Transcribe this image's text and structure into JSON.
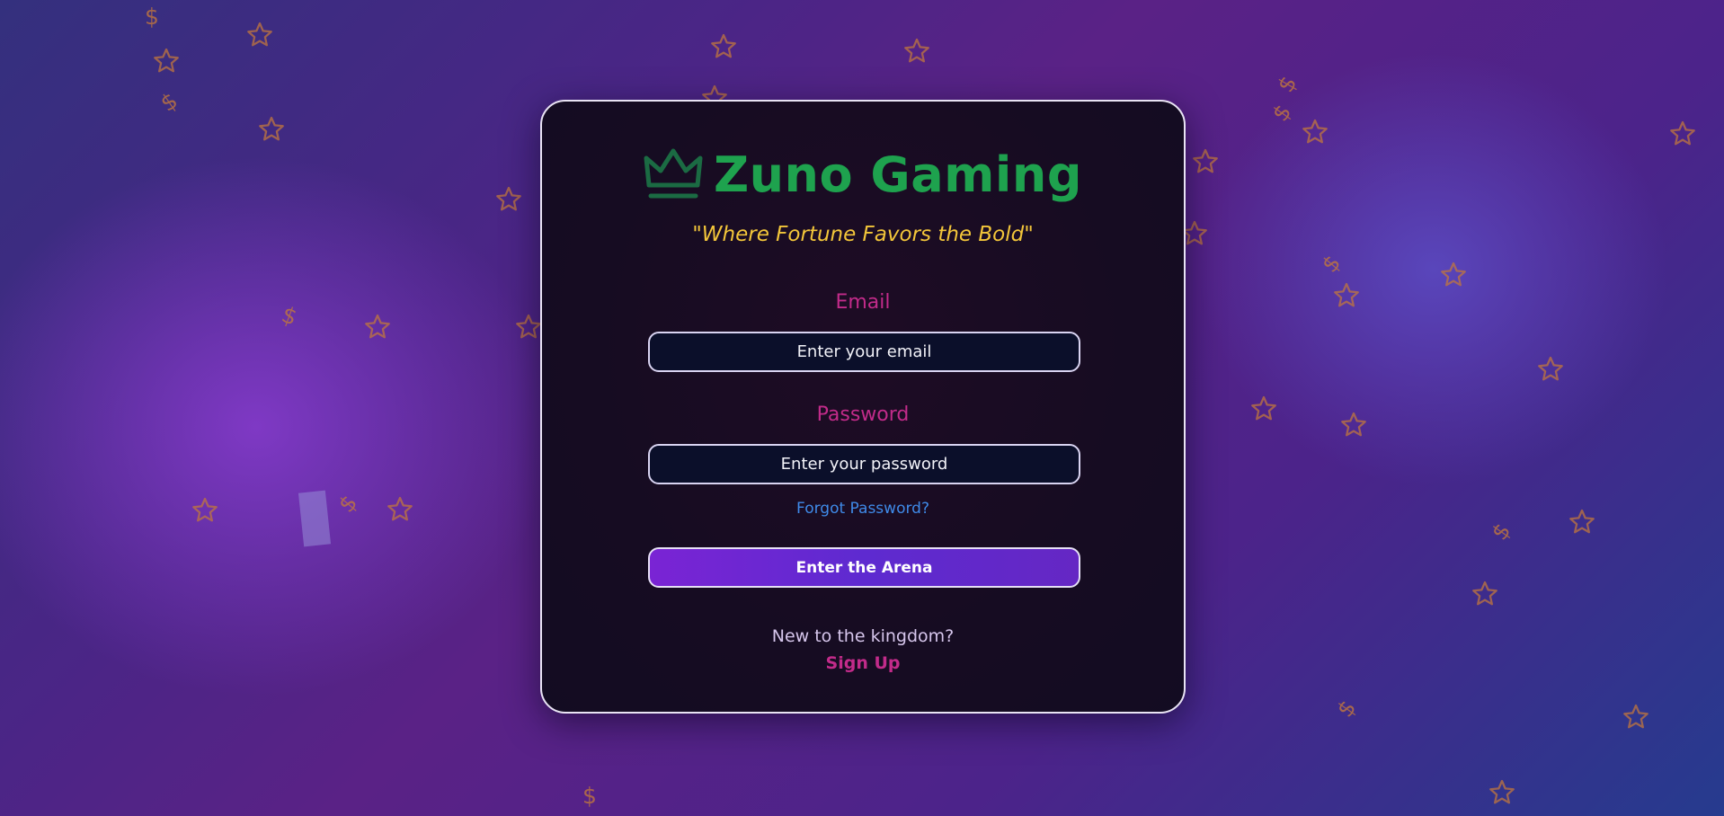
{
  "brand": {
    "name": "Zuno Gaming",
    "icon": "crown-icon",
    "tagline": "\"Where Fortune Favors the Bold\""
  },
  "form": {
    "email_label": "Email",
    "email_placeholder": "Enter your email",
    "password_label": "Password",
    "password_placeholder": "Enter your password",
    "forgot_password": "Forgot Password?",
    "submit_label": "Enter the Arena"
  },
  "signup": {
    "prompt": "New to the kingdom?",
    "link": "Sign Up"
  },
  "background": {
    "decorations": [
      "star-icon",
      "dollar-icon"
    ],
    "dollar_glyph": "$"
  },
  "colors": {
    "brand_green": "#1ea24e",
    "tagline_gold": "#f3c63a",
    "label_magenta": "#c22b8a",
    "link_blue": "#3f8ae8",
    "button_purple": "#6a28d2"
  }
}
